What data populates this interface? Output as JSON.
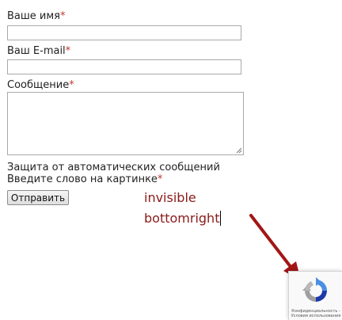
{
  "form": {
    "name_label": "Ваше имя",
    "email_label": "Ваш E-mail",
    "message_label": "Сообщение",
    "required_mark": "*",
    "name_value": "",
    "email_value": "",
    "message_value": "",
    "captcha_line1": "Защита от автоматических сообщений",
    "captcha_line2": "Введите слово на картинке",
    "submit_label": "Отправить"
  },
  "annotation": {
    "line1": "invisible",
    "line2": "bottomright",
    "color": "#8b1a1a"
  },
  "recaptcha": {
    "icon": "recaptcha-logo-icon",
    "privacy_link": "Конфиденциальность -",
    "terms_link": "Условия использования"
  },
  "colors": {
    "required": "#c0392b",
    "arrow": "#a31515"
  }
}
